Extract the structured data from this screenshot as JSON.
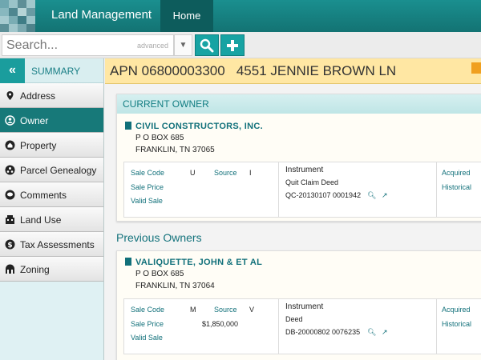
{
  "header": {
    "app_title": "Land Management",
    "home_tab": "Home"
  },
  "search": {
    "placeholder": "Search...",
    "advanced_label": "advanced"
  },
  "sidebar": {
    "summary_label": "SUMMARY",
    "items": [
      {
        "label": "Address",
        "icon": "map-pin-icon"
      },
      {
        "label": "Owner",
        "icon": "person-icon",
        "active": true
      },
      {
        "label": "Property",
        "icon": "house-icon"
      },
      {
        "label": "Parcel Genealogy",
        "icon": "genealogy-icon"
      },
      {
        "label": "Comments",
        "icon": "comment-icon"
      },
      {
        "label": "Land Use",
        "icon": "building-icon"
      },
      {
        "label": "Tax Assessments",
        "icon": "dollar-icon"
      },
      {
        "label": "Zoning",
        "icon": "zoning-icon"
      }
    ]
  },
  "parcel": {
    "apn_line": "APN 06800003300   4551 JENNIE BROWN LN"
  },
  "current_owner": {
    "section_title": "CURRENT OWNER",
    "name": "CIVIL CONSTRUCTORS, INC.",
    "address_line1": "P O BOX 685",
    "address_line2": "FRANKLIN, TN 37065",
    "sale_code_label": "Sale Code",
    "sale_code": "U",
    "source_label": "Source",
    "source": "I",
    "sale_price_label": "Sale Price",
    "sale_price": "",
    "valid_sale_label": "Valid Sale",
    "instrument_label": "Instrument",
    "instrument_type": "Quit Claim Deed",
    "instrument_number": "QC-20130107 0001942",
    "acquired_label": "Acquired",
    "historical_label": "Historical"
  },
  "previous_owners": {
    "section_title": "Previous Owners",
    "owners": [
      {
        "name": "VALIQUETTE, JOHN & ET AL",
        "address_line1": "P O BOX 685",
        "address_line2": "FRANKLIN, TN 37064",
        "sale_code_label": "Sale Code",
        "sale_code": "M",
        "source_label": "Source",
        "source": "V",
        "sale_price_label": "Sale Price",
        "sale_price": "$1,850,000",
        "valid_sale_label": "Valid Sale",
        "instrument_label": "Instrument",
        "instrument_type": "Deed",
        "instrument_number": "DB-20000802 0076235",
        "acquired_label": "Acquired",
        "historical_label": "Historical"
      }
    ]
  },
  "colors": {
    "teal": "#177979",
    "accent": "#1a9d9d",
    "apn_bg": "#ffe7a3",
    "link": "#11707a"
  }
}
